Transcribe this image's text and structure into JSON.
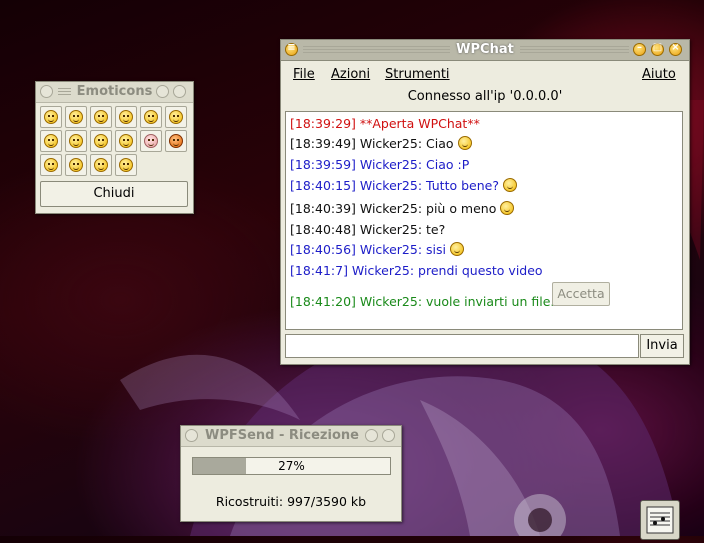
{
  "chat": {
    "title": "WPChat",
    "menu": {
      "file": "File",
      "azioni": "Azioni",
      "strumenti": "Strumenti",
      "aiuto": "Aiuto"
    },
    "status": "Connesso all'ip '0.0.0.0'",
    "messages": [
      {
        "text": "[18:39:29]  **Aperta WPChat**",
        "color": "#d01010",
        "emoticon": false
      },
      {
        "text": "[18:39:49] Wicker25: Ciao",
        "color": "#111111",
        "emoticon": true
      },
      {
        "text": "[18:39:59] Wicker25: Ciao :P",
        "color": "#1d1dc8",
        "emoticon": false
      },
      {
        "text": "[18:40:15] Wicker25: Tutto bene?",
        "color": "#1d1dc8",
        "emoticon": true
      },
      {
        "text": "[18:40:39] Wicker25: più o meno",
        "color": "#111111",
        "emoticon": true
      },
      {
        "text": "[18:40:48] Wicker25: te?",
        "color": "#111111",
        "emoticon": false
      },
      {
        "text": "[18:40:56] Wicker25: sisi",
        "color": "#1d1dc8",
        "emoticon": true
      },
      {
        "text": "[18:41:7] Wicker25: prendi questo video",
        "color": "#1d1dc8",
        "emoticon": false
      },
      {
        "text": "[18:41:20] Wicker25: vuole inviarti un file.",
        "color": "#1a8a1a",
        "emoticon": false
      }
    ],
    "accept_label": "Accetta",
    "input_value": "",
    "send_label": "Invia"
  },
  "emoticons": {
    "title": "Emoticons",
    "icons": [
      "smile-icon",
      "grin-icon",
      "cool-icon",
      "blush-icon",
      "sad-icon",
      "laugh-icon",
      "surprised-icon",
      "neutral-icon",
      "sunglasses-icon",
      "nerd-icon",
      "pig-icon",
      "devil-icon",
      "tongue-icon",
      "shocked-icon",
      "confused-icon",
      "wink-icon"
    ],
    "close_label": "Chiudi"
  },
  "transfer": {
    "title": "WPFSend - Ricezione",
    "progress_percent": 27,
    "progress_label": "27%",
    "received_label": "Ricostruiti: 997/3590 kb"
  },
  "colors": {
    "accent": "#f2b800",
    "window_bg": "#edecdf"
  }
}
